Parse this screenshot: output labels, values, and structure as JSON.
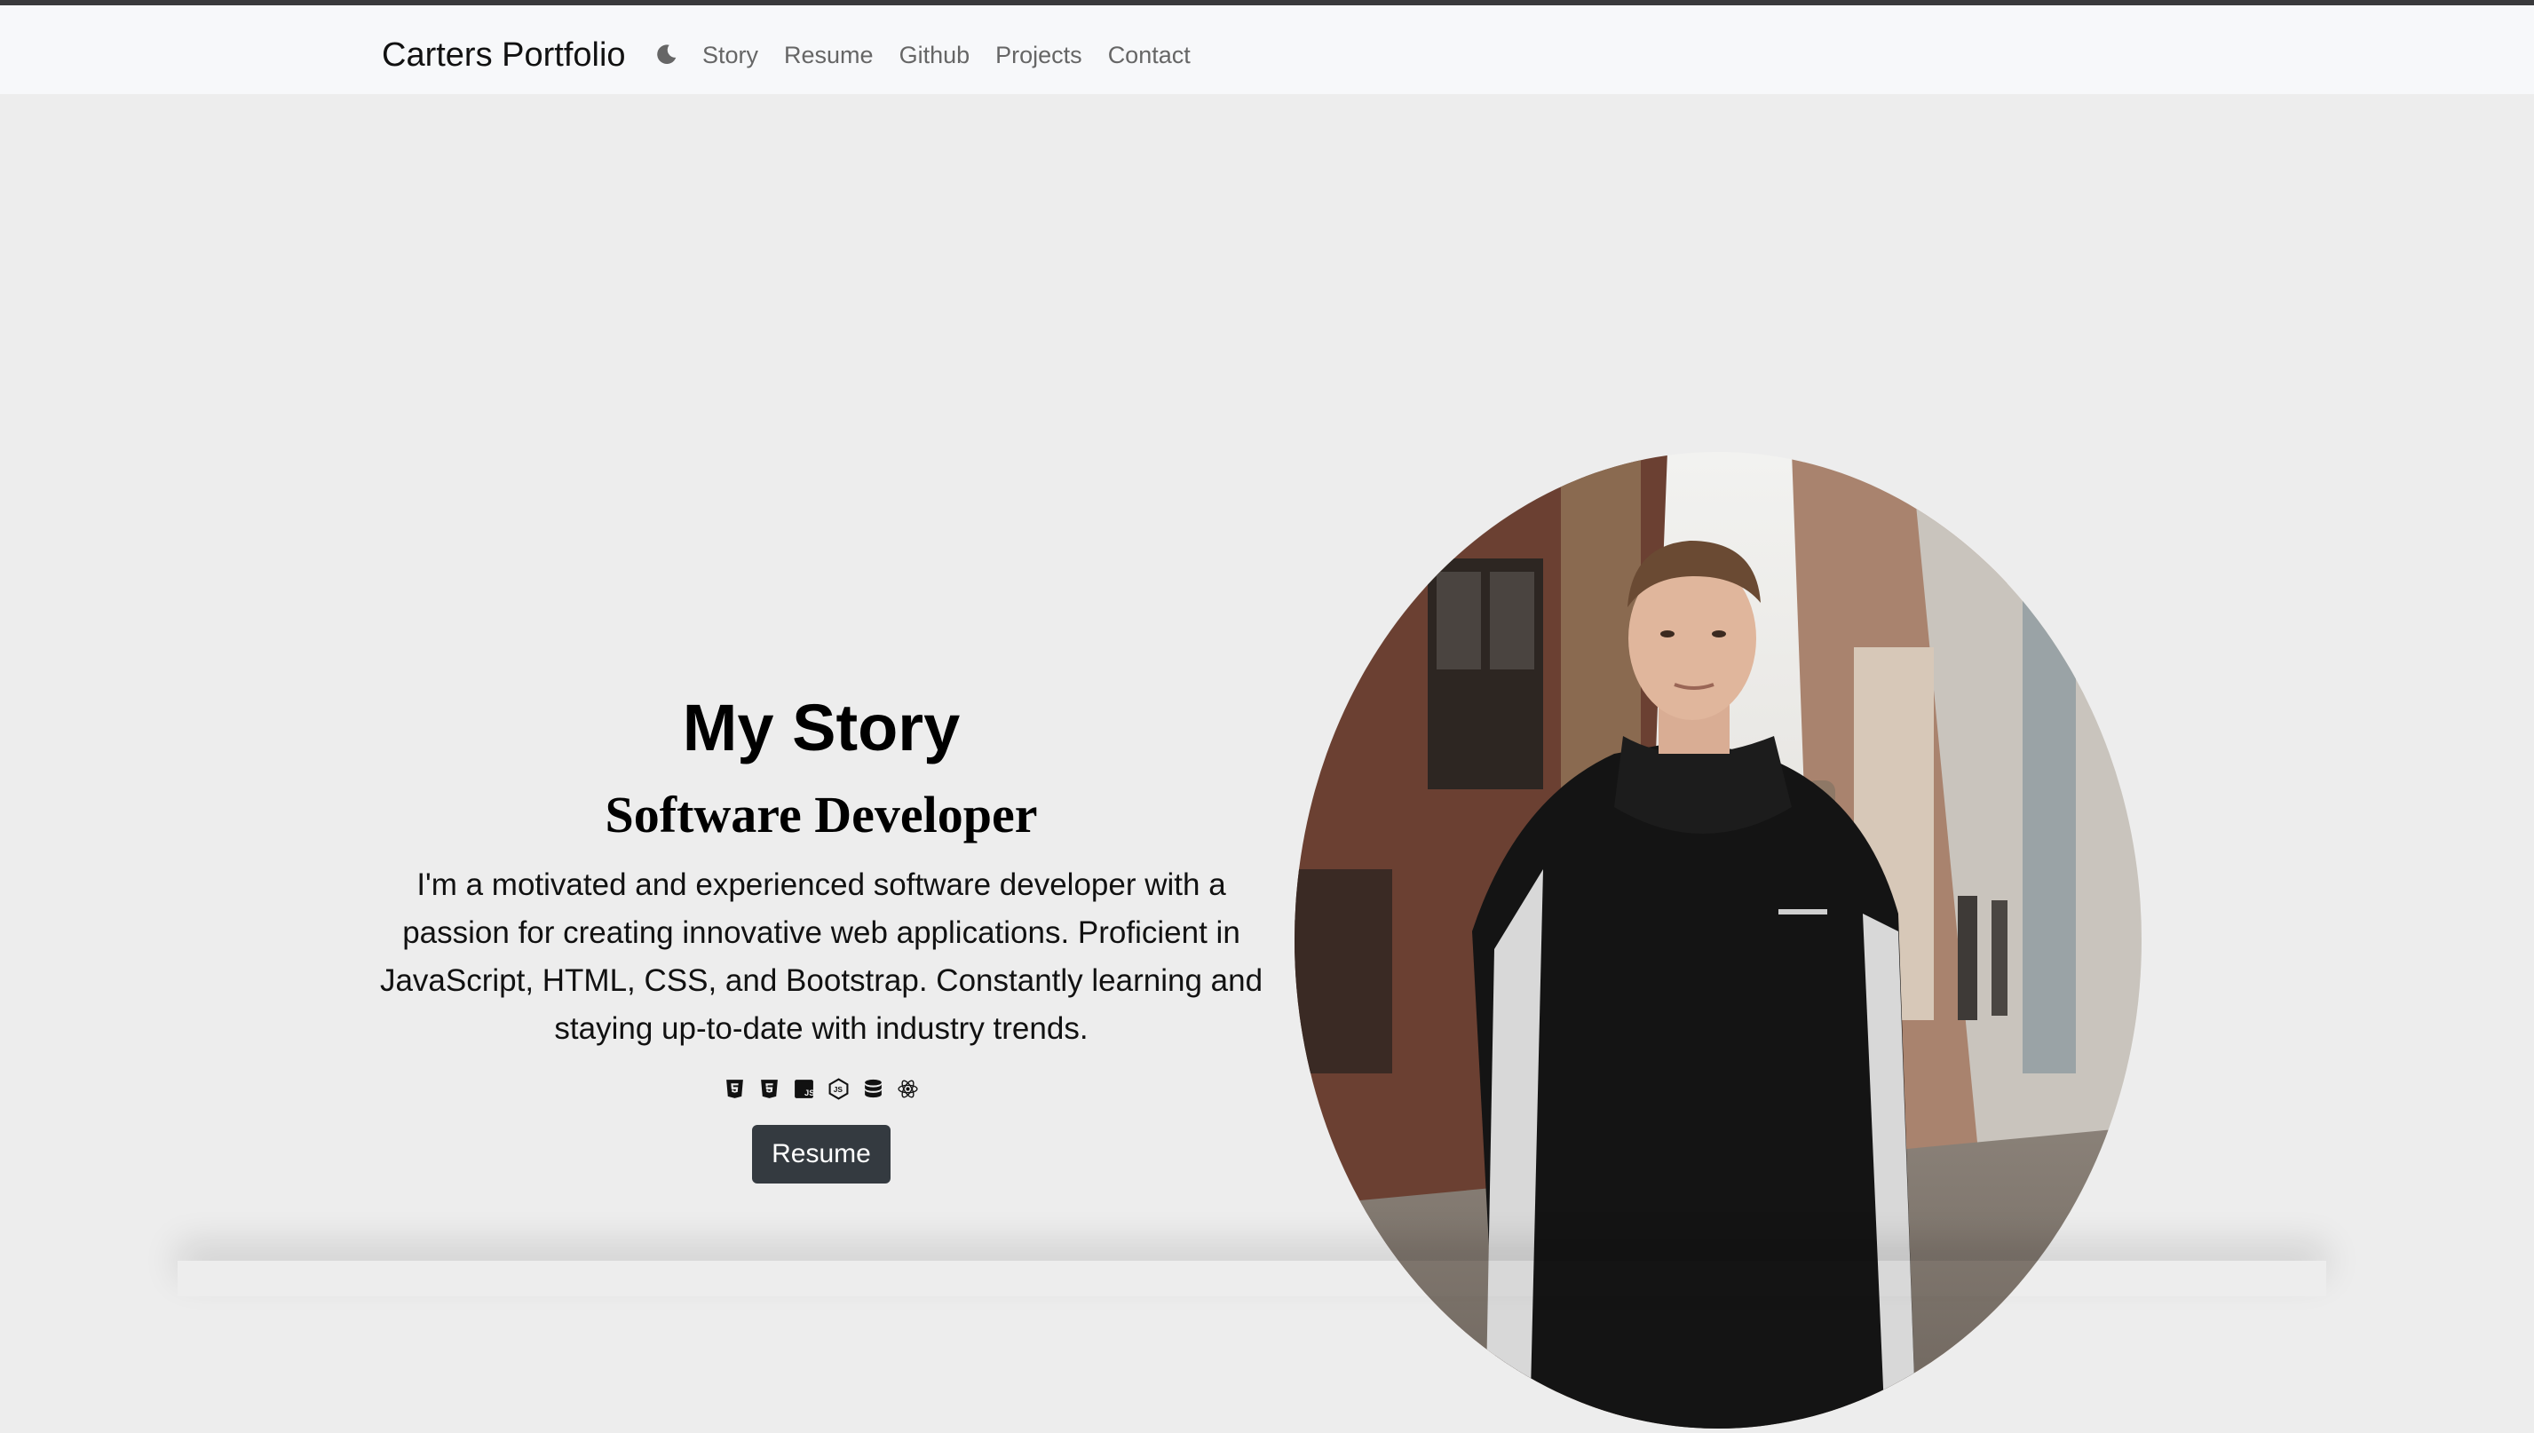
{
  "nav": {
    "brand": "Carters Portfolio",
    "theme_toggle_icon": "moon-icon",
    "links": [
      "Story",
      "Resume",
      "Github",
      "Projects",
      "Contact"
    ]
  },
  "hero": {
    "title": "My Story",
    "subtitle": "Software Developer",
    "description": "I'm a motivated and experienced software developer with a passion for creating innovative web applications. Proficient in JavaScript, HTML, CSS, and Bootstrap. Constantly learning and staying up-to-date with industry trends.",
    "tech_icons": [
      "html5-icon",
      "css3-icon",
      "javascript-icon",
      "nodejs-icon",
      "database-icon",
      "react-icon"
    ],
    "button_label": "Resume",
    "photo_alt": "profile-photo"
  },
  "colors": {
    "background": "#ededed",
    "navbar": "#f7f8fa",
    "button": "#343a40"
  }
}
